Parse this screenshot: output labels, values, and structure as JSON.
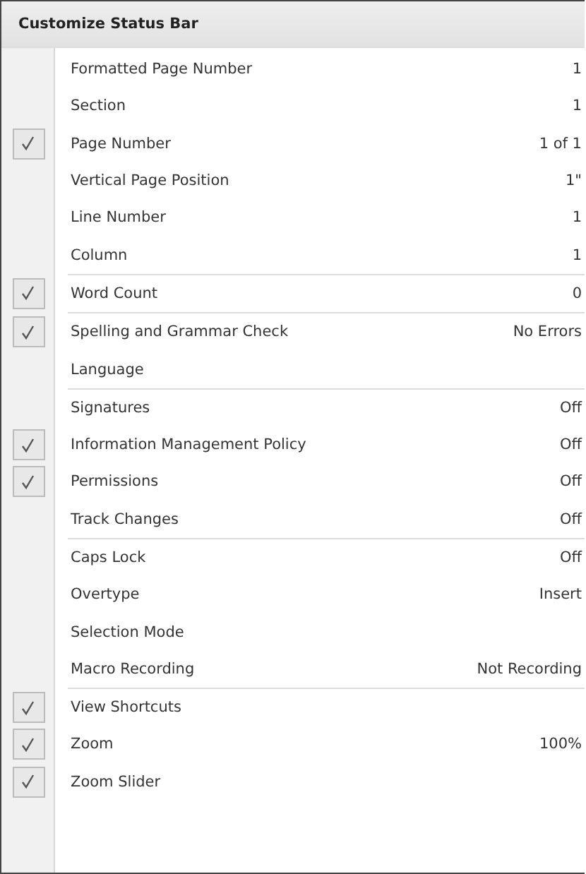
{
  "menu": {
    "title": "Customize Status Bar",
    "groups": [
      {
        "items": [
          {
            "label": "Formatted Page Number",
            "value": "1",
            "checked": false
          },
          {
            "label": "Section",
            "value": "1",
            "checked": false
          },
          {
            "label": "Page Number",
            "value": "1 of 1",
            "checked": true
          },
          {
            "label": "Vertical Page Position",
            "value": "1\"",
            "checked": false
          },
          {
            "label": "Line Number",
            "value": "1",
            "checked": false
          },
          {
            "label": "Column",
            "value": "1",
            "checked": false
          }
        ]
      },
      {
        "items": [
          {
            "label": "Word Count",
            "value": "0",
            "checked": true
          }
        ]
      },
      {
        "items": [
          {
            "label": "Spelling and Grammar Check",
            "value": "No Errors",
            "checked": true
          },
          {
            "label": "Language",
            "checked": false
          }
        ]
      },
      {
        "items": [
          {
            "label": "Signatures",
            "value": "Off",
            "checked": false
          },
          {
            "label": "Information Management Policy",
            "value": "Off",
            "checked": true
          },
          {
            "label": "Permissions",
            "value": "Off",
            "checked": true
          },
          {
            "label": "Track Changes",
            "value": "Off",
            "checked": false
          }
        ]
      },
      {
        "items": [
          {
            "label": "Caps Lock",
            "value": "Off",
            "checked": false
          },
          {
            "label": "Overtype",
            "value": "Insert",
            "checked": false
          },
          {
            "label": "Selection Mode",
            "checked": false
          },
          {
            "label": "Macro Recording",
            "value": "Not Recording",
            "checked": false
          }
        ]
      },
      {
        "items": [
          {
            "label": "View Shortcuts",
            "checked": true
          },
          {
            "label": "Zoom",
            "value": "100%",
            "checked": true
          },
          {
            "label": "Zoom Slider",
            "checked": true
          }
        ]
      }
    ]
  }
}
